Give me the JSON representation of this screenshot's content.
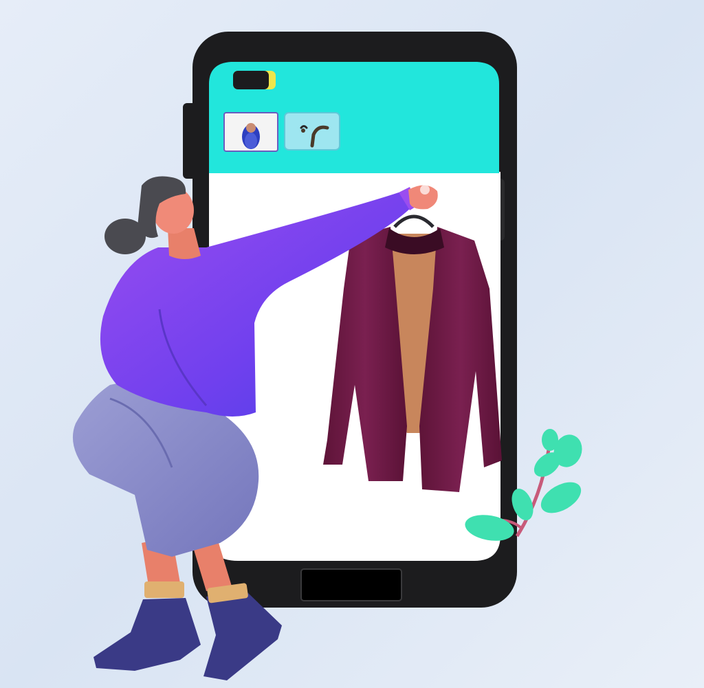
{
  "colors": {
    "background": "#dfe8f5",
    "phone_frame": "#1c1c1e",
    "screen_header": "#22e6dc",
    "screen_body": "#ffffff",
    "sweater": "#7b4df0",
    "pants": "#8a8cc8",
    "boots": "#3a3a86",
    "coat": "#6f1a45",
    "coat_lining": "#c8865c",
    "leaves": "#3fe0b0"
  },
  "icons": {
    "battery": "battery-icon",
    "thumbnail_person": "person-thumbnail-icon",
    "thumbnail_hanger": "hanger-thumbnail-icon",
    "home_button": "home-button"
  }
}
